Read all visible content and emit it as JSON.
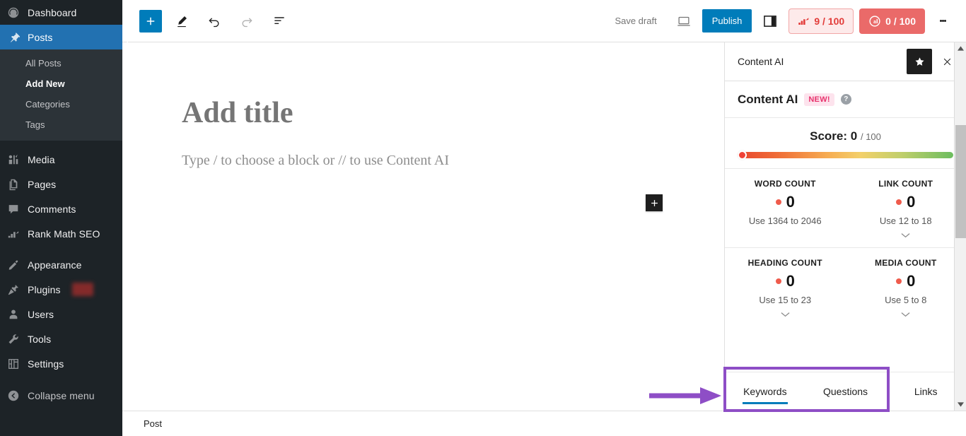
{
  "sidebar": {
    "items": [
      {
        "label": "Dashboard",
        "icon": "dashboard-icon",
        "current": false
      },
      {
        "label": "Posts",
        "icon": "pin-icon",
        "current": true
      },
      {
        "label": "Media",
        "icon": "media-icon",
        "current": false
      },
      {
        "label": "Pages",
        "icon": "pages-icon",
        "current": false
      },
      {
        "label": "Comments",
        "icon": "comments-icon",
        "current": false
      },
      {
        "label": "Rank Math SEO",
        "icon": "rankmath-icon",
        "current": false
      },
      {
        "label": "Appearance",
        "icon": "appearance-icon",
        "current": false
      },
      {
        "label": "Plugins",
        "icon": "plugins-icon",
        "current": false
      },
      {
        "label": "Users",
        "icon": "users-icon",
        "current": false
      },
      {
        "label": "Tools",
        "icon": "tools-icon",
        "current": false
      },
      {
        "label": "Settings",
        "icon": "settings-icon",
        "current": false
      }
    ],
    "posts_submenu": [
      {
        "label": "All Posts",
        "current": false
      },
      {
        "label": "Add New",
        "current": true
      },
      {
        "label": "Categories",
        "current": false
      },
      {
        "label": "Tags",
        "current": false
      }
    ],
    "collapse_label": "Collapse menu",
    "active_color": "#2271b1",
    "background_color": "#1d2327"
  },
  "toolbar": {
    "add_block_title": "Toggle block inserter",
    "tools_title": "Tools",
    "undo_title": "Undo",
    "redo_title": "Redo",
    "outline_title": "Details",
    "save_draft_label": "Save draft",
    "preview_title": "Preview",
    "publish_label": "Publish",
    "settings_toggle_title": "Settings",
    "seo_score": "9 / 100",
    "content_ai_score": "0 / 100",
    "options_title": "Options",
    "publish_color": "#007cba",
    "seo_badge_color": "#e23c39",
    "content_ai_badge_color": "#ea6a69"
  },
  "editor": {
    "title_placeholder": "Add title",
    "body_placeholder": "Type / to choose a block or // to use Content AI",
    "inline_inserter_title": "Add block",
    "breadcrumb": "Post"
  },
  "panel": {
    "header_title": "Content AI",
    "pin_title": "Pin to toolbar",
    "close_title": "Close plugin",
    "section_title": "Content AI",
    "new_badge": "NEW!",
    "help_glyph": "?",
    "score": {
      "label": "Score:",
      "value": "0",
      "max": "/ 100",
      "knob_color": "#ef4136"
    },
    "stats": [
      {
        "title": "WORD COUNT",
        "value": "0",
        "hint": "Use 1364 to 2046",
        "chevron": false
      },
      {
        "title": "LINK COUNT",
        "value": "0",
        "hint": "Use 12 to 18",
        "chevron": true
      },
      {
        "title": "HEADING COUNT",
        "value": "0",
        "hint": "Use 15 to 23",
        "chevron": true
      },
      {
        "title": "MEDIA COUNT",
        "value": "0",
        "hint": "Use 5 to 8",
        "chevron": true
      }
    ],
    "tabs": [
      {
        "label": "Keywords",
        "active": true
      },
      {
        "label": "Questions",
        "active": false
      },
      {
        "label": "Links",
        "active": false
      }
    ]
  },
  "annotation": {
    "color": "#8e4ec6",
    "target": "Keywords and Questions tabs"
  }
}
